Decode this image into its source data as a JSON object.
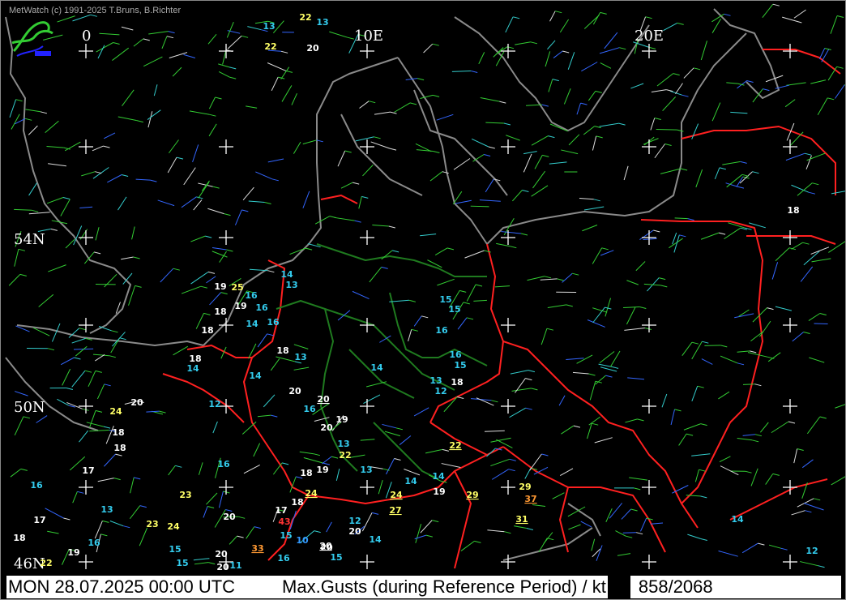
{
  "app": {
    "credit": "MetWatch  (c) 1991-2025 T.Bruns, B.Richter",
    "logo_icon": "metwatch-logo-icon"
  },
  "map": {
    "lon_labels": [
      "0",
      "10E",
      "20E"
    ],
    "lat_labels": [
      "54N",
      "50N",
      "46N"
    ],
    "colors": {
      "background": "#000000",
      "coast": "#8a8a8a",
      "borders": "#ff2020",
      "german_states": "#1f7a1f",
      "grid": "#ffffff",
      "label_white": "#ffffff",
      "label_cyan": "#33ccee",
      "label_yellow": "#ffff66",
      "label_orange": "#ff9933",
      "label_red": "#ff3333",
      "label_blue": "#3399ff",
      "wind_green": "#33cc33",
      "wind_blue": "#3366ff",
      "wind_cyan": "#33cccc",
      "wind_white": "#dddddd"
    },
    "gust_labels": [
      {
        "t": "13",
        "c": "cyan"
      },
      {
        "t": "22",
        "c": "yellow"
      },
      {
        "t": "13",
        "c": "cyan"
      },
      {
        "t": "22",
        "c": "yellow"
      },
      {
        "t": "20",
        "c": "white"
      },
      {
        "t": "18",
        "c": "white"
      },
      {
        "t": "14",
        "c": "cyan"
      },
      {
        "t": "13",
        "c": "cyan"
      },
      {
        "t": "19",
        "c": "white"
      },
      {
        "t": "25",
        "c": "yellow"
      },
      {
        "t": "16",
        "c": "cyan"
      },
      {
        "t": "19",
        "c": "white"
      },
      {
        "t": "16",
        "c": "cyan"
      },
      {
        "t": "18",
        "c": "white"
      },
      {
        "t": "14",
        "c": "cyan"
      },
      {
        "t": "16",
        "c": "cyan"
      },
      {
        "t": "18",
        "c": "white"
      },
      {
        "t": "18",
        "c": "white"
      },
      {
        "t": "13",
        "c": "cyan"
      },
      {
        "t": "18",
        "c": "white"
      },
      {
        "t": "14",
        "c": "cyan"
      },
      {
        "t": "14",
        "c": "cyan"
      },
      {
        "t": "14",
        "c": "cyan"
      },
      {
        "t": "15",
        "c": "cyan"
      },
      {
        "t": "15",
        "c": "cyan"
      },
      {
        "t": "16",
        "c": "cyan"
      },
      {
        "t": "16",
        "c": "cyan"
      },
      {
        "t": "15",
        "c": "cyan"
      },
      {
        "t": "13",
        "c": "cyan"
      },
      {
        "t": "18",
        "c": "white"
      },
      {
        "t": "12",
        "c": "cyan"
      },
      {
        "t": "20",
        "c": "white"
      },
      {
        "t": "20",
        "c": "white",
        "u": true
      },
      {
        "t": "16",
        "c": "cyan"
      },
      {
        "t": "19",
        "c": "white"
      },
      {
        "t": "20",
        "c": "white"
      },
      {
        "t": "12",
        "c": "cyan"
      },
      {
        "t": "24",
        "c": "yellow"
      },
      {
        "t": "20",
        "c": "white"
      },
      {
        "t": "18",
        "c": "white"
      },
      {
        "t": "18",
        "c": "white"
      },
      {
        "t": "13",
        "c": "cyan"
      },
      {
        "t": "22",
        "c": "yellow"
      },
      {
        "t": "22",
        "c": "yellow",
        "u": true
      },
      {
        "t": "16",
        "c": "cyan"
      },
      {
        "t": "17",
        "c": "white"
      },
      {
        "t": "18",
        "c": "white"
      },
      {
        "t": "19",
        "c": "white"
      },
      {
        "t": "13",
        "c": "cyan"
      },
      {
        "t": "14",
        "c": "cyan"
      },
      {
        "t": "14",
        "c": "cyan"
      },
      {
        "t": "16",
        "c": "cyan"
      },
      {
        "t": "23",
        "c": "yellow"
      },
      {
        "t": "24",
        "c": "yellow",
        "u": true
      },
      {
        "t": "18",
        "c": "white"
      },
      {
        "t": "24",
        "c": "yellow",
        "u": true
      },
      {
        "t": "19",
        "c": "white"
      },
      {
        "t": "29",
        "c": "yellow",
        "u": true
      },
      {
        "t": "29",
        "c": "yellow"
      },
      {
        "t": "37",
        "c": "orange",
        "u": true
      },
      {
        "t": "13",
        "c": "cyan"
      },
      {
        "t": "17",
        "c": "white"
      },
      {
        "t": "20",
        "c": "white"
      },
      {
        "t": "17",
        "c": "white"
      },
      {
        "t": "43",
        "c": "red"
      },
      {
        "t": "27",
        "c": "yellow",
        "u": true
      },
      {
        "t": "12",
        "c": "cyan"
      },
      {
        "t": "31",
        "c": "yellow",
        "u": true
      },
      {
        "t": "14",
        "c": "cyan"
      },
      {
        "t": "18",
        "c": "white"
      },
      {
        "t": "16",
        "c": "cyan"
      },
      {
        "t": "23",
        "c": "yellow"
      },
      {
        "t": "24",
        "c": "yellow"
      },
      {
        "t": "15",
        "c": "cyan"
      },
      {
        "t": "10",
        "c": "blue"
      },
      {
        "t": "20",
        "c": "white"
      },
      {
        "t": "14",
        "c": "cyan"
      },
      {
        "t": "20",
        "c": "white"
      },
      {
        "t": "19",
        "c": "white"
      },
      {
        "t": "15",
        "c": "cyan"
      },
      {
        "t": "20",
        "c": "white"
      },
      {
        "t": "33",
        "c": "orange",
        "u": true
      },
      {
        "t": "16",
        "c": "cyan"
      },
      {
        "t": "20",
        "c": "white",
        "u": true
      },
      {
        "t": "15",
        "c": "cyan"
      },
      {
        "t": "12",
        "c": "cyan"
      },
      {
        "t": "22",
        "c": "yellow"
      },
      {
        "t": "15",
        "c": "cyan"
      },
      {
        "t": "20",
        "c": "white"
      },
      {
        "t": "11",
        "c": "cyan"
      }
    ]
  },
  "status": {
    "datetime": "MON 28.07.2025 00:00 UTC",
    "title": "Max.Gusts (during Reference Period) / kt",
    "count": "858/2068"
  }
}
